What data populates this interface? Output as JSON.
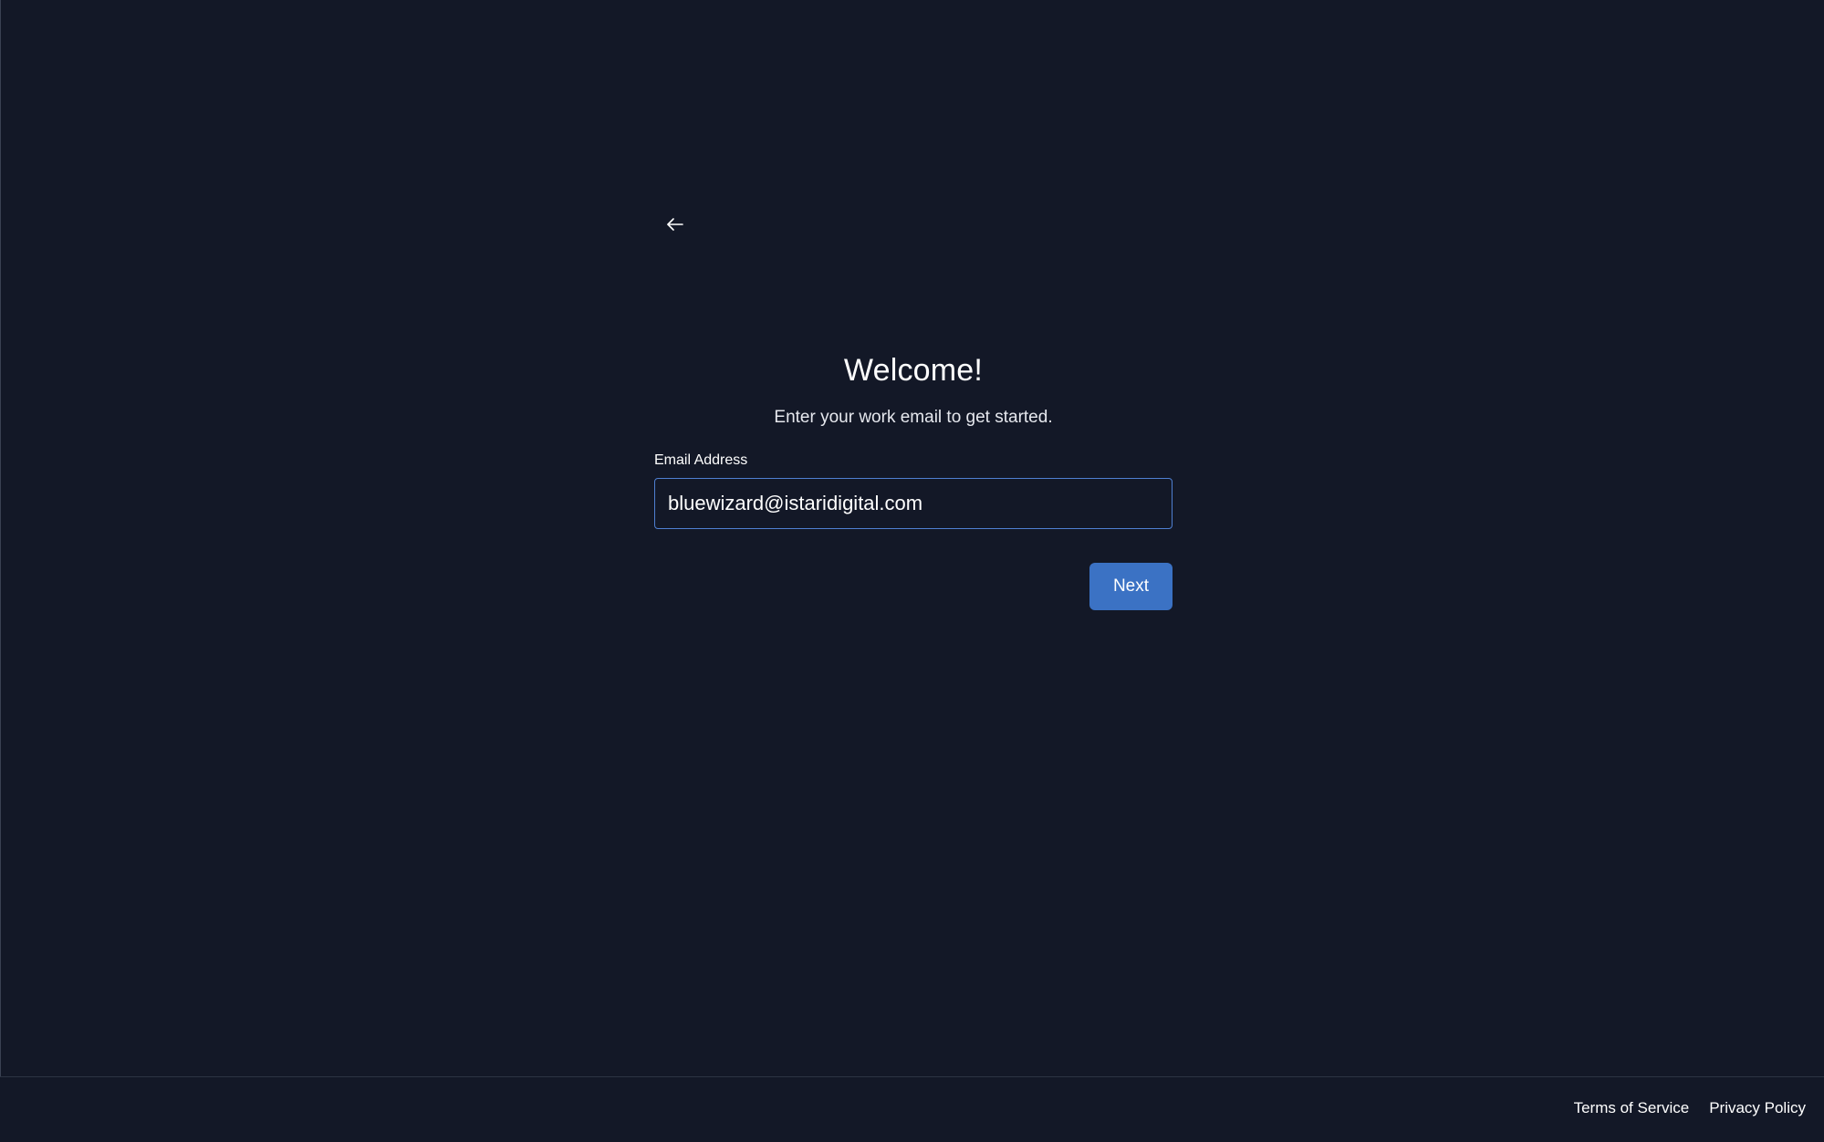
{
  "icons": {
    "back": "arrow-left-icon"
  },
  "colors": {
    "background": "#131827",
    "accent": "#3b72c4",
    "input_border": "#4f7fd1"
  },
  "main": {
    "title": "Welcome!",
    "subtitle": "Enter your work email to get started.",
    "email_label": "Email Address",
    "email_value": "bluewizard@istaridigital.com",
    "next_label": "Next"
  },
  "footer": {
    "terms_label": "Terms of Service",
    "privacy_label": "Privacy Policy"
  }
}
